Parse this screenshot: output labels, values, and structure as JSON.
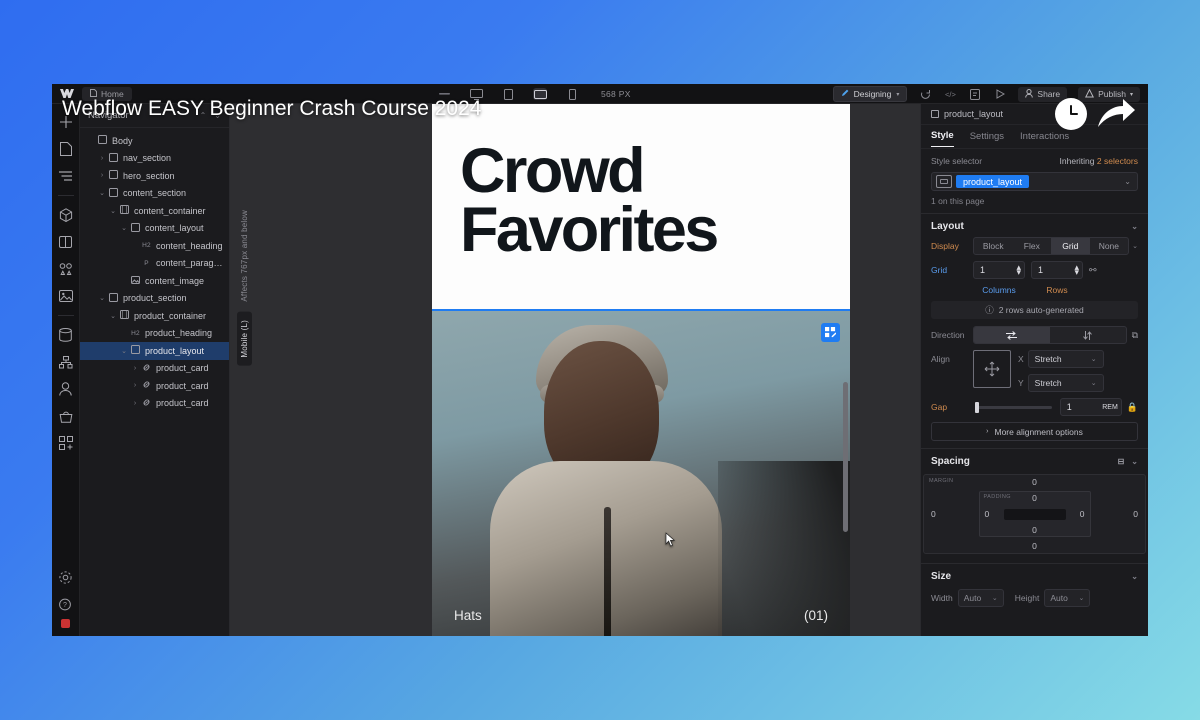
{
  "video": {
    "title": "Webflow EASY Beginner Crash Course 2024",
    "overlay_icons": [
      "clock-icon",
      "share-arrow-icon"
    ]
  },
  "topbar": {
    "logo": "webflow-logo-icon",
    "home_label": "Home",
    "page_icon": "page-icon",
    "center_tools": [
      {
        "name": "dash-icon",
        "glyph": "—"
      },
      {
        "name": "desktop-icon",
        "glyph": "⬜"
      },
      {
        "name": "tablet-icon",
        "glyph": "▯"
      },
      {
        "name": "mobile-landscape-icon",
        "glyph": "▭"
      },
      {
        "name": "mobile-portrait-icon",
        "glyph": "▯"
      }
    ],
    "px_label": "568 PX",
    "mode": "Designing",
    "right_icons": [
      {
        "name": "refresh-icon",
        "glyph": "↻"
      },
      {
        "name": "code-icon",
        "glyph": "</>"
      },
      {
        "name": "audit-icon",
        "glyph": "☰"
      },
      {
        "name": "preview-icon",
        "glyph": "▷"
      }
    ],
    "share_label": "Share",
    "publish_label": "Publish"
  },
  "rail": {
    "items": [
      {
        "name": "add-element-icon",
        "glyph": "+"
      },
      {
        "name": "pages-icon",
        "glyph": "□"
      },
      {
        "name": "navigator-icon",
        "glyph": "☰"
      },
      {
        "name": "components-icon",
        "glyph": "⬡"
      },
      {
        "name": "variables-icon",
        "glyph": "◧"
      },
      {
        "name": "style-manager-icon",
        "glyph": "⚘"
      },
      {
        "name": "assets-icon",
        "glyph": "Ὓc"
      },
      {
        "name": "cms-icon",
        "glyph": "⛁"
      },
      {
        "name": "logic-icon",
        "glyph": "⑂"
      },
      {
        "name": "users-icon",
        "glyph": "☺"
      },
      {
        "name": "ecommerce-icon",
        "glyph": "⛉"
      },
      {
        "name": "apps-icon",
        "glyph": "⊞"
      }
    ],
    "bottom_items": [
      {
        "name": "settings-gear-icon",
        "glyph": "⚙"
      },
      {
        "name": "help-icon",
        "glyph": "?"
      }
    ]
  },
  "navigator": {
    "title": "Navigator",
    "tree": [
      {
        "label": "Body",
        "indent": 0,
        "caret": "",
        "icon": "box-icon",
        "tag": ""
      },
      {
        "label": "nav_section",
        "indent": 1,
        "caret": "›",
        "icon": "box-icon",
        "tag": ""
      },
      {
        "label": "hero_section",
        "indent": 1,
        "caret": "›",
        "icon": "box-icon",
        "tag": ""
      },
      {
        "label": "content_section",
        "indent": 1,
        "caret": "⌄",
        "icon": "box-icon",
        "tag": ""
      },
      {
        "label": "content_container",
        "indent": 2,
        "caret": "⌄",
        "icon": "container-icon",
        "tag": ""
      },
      {
        "label": "content_layout",
        "indent": 3,
        "caret": "⌄",
        "icon": "box-icon",
        "tag": ""
      },
      {
        "label": "content_heading",
        "indent": 4,
        "caret": "",
        "icon": "",
        "tag": "H2"
      },
      {
        "label": "content_paragra..",
        "indent": 4,
        "caret": "",
        "icon": "",
        "tag": "P"
      },
      {
        "label": "content_image",
        "indent": 3,
        "caret": "",
        "icon": "image-icon",
        "tag": ""
      },
      {
        "label": "product_section",
        "indent": 1,
        "caret": "⌄",
        "icon": "box-icon",
        "tag": ""
      },
      {
        "label": "product_container",
        "indent": 2,
        "caret": "⌄",
        "icon": "container-icon",
        "tag": ""
      },
      {
        "label": "product_heading",
        "indent": 3,
        "caret": "",
        "icon": "",
        "tag": "H2"
      },
      {
        "label": "product_layout",
        "indent": 3,
        "caret": "⌄",
        "icon": "box-icon",
        "tag": "",
        "selected": true
      },
      {
        "label": "product_card",
        "indent": 4,
        "caret": "›",
        "icon": "link-icon",
        "tag": ""
      },
      {
        "label": "product_card",
        "indent": 4,
        "caret": "›",
        "icon": "link-icon",
        "tag": ""
      },
      {
        "label": "product_card",
        "indent": 4,
        "caret": "›",
        "icon": "link-icon",
        "tag": ""
      }
    ]
  },
  "canvas": {
    "breakpoint_note": "Affects 767px and below",
    "breakpoint_name": "Mobile (L)",
    "hero_heading": "Crowd Favorites",
    "selection_badge": "product_layout",
    "grid_edit_icon": "grid-edit-icon",
    "card_label": "Hats",
    "card_index": "(01)"
  },
  "style_panel": {
    "element_name": "product_layout",
    "tabs": [
      {
        "label": "Style",
        "active": true
      },
      {
        "label": "Settings",
        "active": false
      },
      {
        "label": "Interactions",
        "active": false
      }
    ],
    "selector": {
      "label": "Style selector",
      "inheriting_prefix": "Inheriting",
      "inheriting_count": "2 selectors",
      "current": "product_layout",
      "note": "1 on this page"
    },
    "layout": {
      "title": "Layout",
      "display_label": "Display",
      "display_options": [
        "Block",
        "Flex",
        "Grid",
        "None"
      ],
      "display_active": "Grid",
      "grid_label": "Grid",
      "columns_value": "1",
      "rows_value": "1",
      "columns_caption": "Columns",
      "rows_caption": "Rows",
      "autogen_note": "2 rows auto-generated",
      "direction_label": "Direction",
      "align_label": "Align",
      "align_x_label": "X",
      "align_x_value": "Stretch",
      "align_y_label": "Y",
      "align_y_value": "Stretch",
      "gap_label": "Gap",
      "gap_value": "1",
      "gap_unit": "REM",
      "more_align": "More alignment options"
    },
    "spacing": {
      "title": "Spacing",
      "margin_label": "MARGIN",
      "padding_label": "PADDING",
      "margin_top": "0",
      "margin_right": "0",
      "margin_bottom": "0",
      "margin_left": "0",
      "padding_top": "0",
      "padding_right": "0",
      "padding_bottom": "0",
      "padding_left": "0"
    },
    "size": {
      "title": "Size",
      "width_label": "Width",
      "width_value": "Auto",
      "height_label": "Height",
      "height_value": "Auto"
    }
  },
  "colors": {
    "accent_blue": "#1f7cf2",
    "panel_bg": "#1b1b1e",
    "canvas_bg": "#2e2e31",
    "orange_label": "#d08b4f",
    "gradient_start": "#2f6df0",
    "gradient_end": "#86dbe6"
  }
}
